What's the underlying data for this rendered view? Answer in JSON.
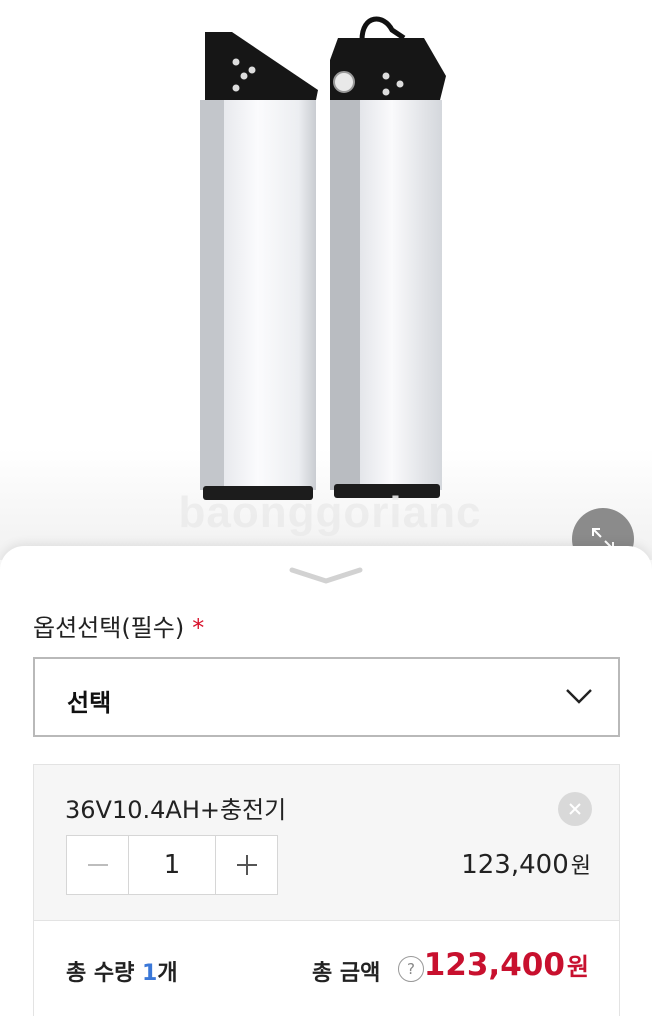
{
  "product": {
    "watermark": "baonggorianc"
  },
  "option": {
    "label": "옵션선택(필수)",
    "required_mark": "*",
    "select_value": "선택"
  },
  "selected_item": {
    "name": "36V10.4AH+충전기",
    "quantity": "1",
    "price": "123,400",
    "currency": "원"
  },
  "totals": {
    "qty_prefix": "총 수량 ",
    "qty_value": "1",
    "qty_suffix": "개",
    "amount_label": "총 금액",
    "help_symbol": "?",
    "amount": "123,400",
    "currency": "원"
  },
  "colors": {
    "accent_red": "#c8102e",
    "qty_blue": "#3b78d8"
  },
  "icons": [
    "expand-icon",
    "sheet-handle-icon",
    "chevron-down-icon",
    "close-icon",
    "minus-icon",
    "plus-icon",
    "help-icon"
  ]
}
